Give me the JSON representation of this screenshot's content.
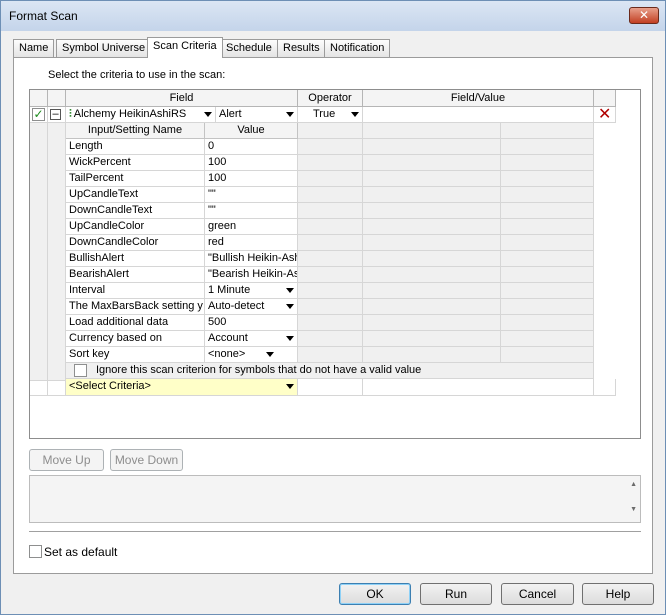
{
  "window": {
    "title": "Format Scan",
    "close_glyph": "✕"
  },
  "tabs": [
    "Name",
    "Symbol Universe",
    "Scan Criteria",
    "Schedule",
    "Results",
    "Notification"
  ],
  "active_tab_index": 2,
  "instruction": "Select the criteria to use in the scan:",
  "grid": {
    "columns": {
      "field": "Field",
      "operator": "Operator",
      "field_value": "Field/Value"
    },
    "criterion": {
      "checked": true,
      "collapse_glyph": "⊟",
      "indicator_icon": "indicator-icon",
      "field": "Alchemy HeikinAshiRS",
      "plot": "Alert",
      "operator": "True",
      "delete_glyph": "✕"
    },
    "inputs_headers": {
      "name": "Input/Setting Name",
      "value": "Value"
    },
    "inputs": [
      {
        "name": "Length",
        "value": "0",
        "dropdown": false
      },
      {
        "name": "WickPercent",
        "value": "100",
        "dropdown": false
      },
      {
        "name": "TailPercent",
        "value": "100",
        "dropdown": false
      },
      {
        "name": "UpCandleText",
        "value": "\"\"",
        "dropdown": false
      },
      {
        "name": "DownCandleText",
        "value": "\"\"",
        "dropdown": false
      },
      {
        "name": "UpCandleColor",
        "value": "green",
        "dropdown": false
      },
      {
        "name": "DownCandleColor",
        "value": "red",
        "dropdown": false
      },
      {
        "name": "BullishAlert",
        "value": "\"Bullish Heikin-Ash",
        "dropdown": false
      },
      {
        "name": "BearishAlert",
        "value": "\"Bearish Heikin-As",
        "dropdown": false
      },
      {
        "name": "Interval",
        "value": "1 Minute",
        "dropdown": true
      },
      {
        "name": "The MaxBarsBack setting y",
        "value": "Auto-detect",
        "dropdown": true
      },
      {
        "name": "Load additional data",
        "value": "500",
        "dropdown": false
      },
      {
        "name": "Currency based on",
        "value": "Account",
        "dropdown": true
      },
      {
        "name": "Sort key",
        "value": "<none>",
        "dropdown": true
      }
    ],
    "ignore_label": "Ignore this scan criterion for symbols that do not have a valid value",
    "select_placeholder": "<Select Criteria>"
  },
  "buttons": {
    "move_up": "Move Up",
    "move_down": "Move Down",
    "ok": "OK",
    "run": "Run",
    "cancel": "Cancel",
    "help": "Help"
  },
  "set_default_label": "Set as default",
  "scroll_up_glyph": "▲",
  "scroll_down_glyph": "▼",
  "colors": {
    "select_row_bg": "#ffffc8",
    "delete_red": "#b00000"
  }
}
